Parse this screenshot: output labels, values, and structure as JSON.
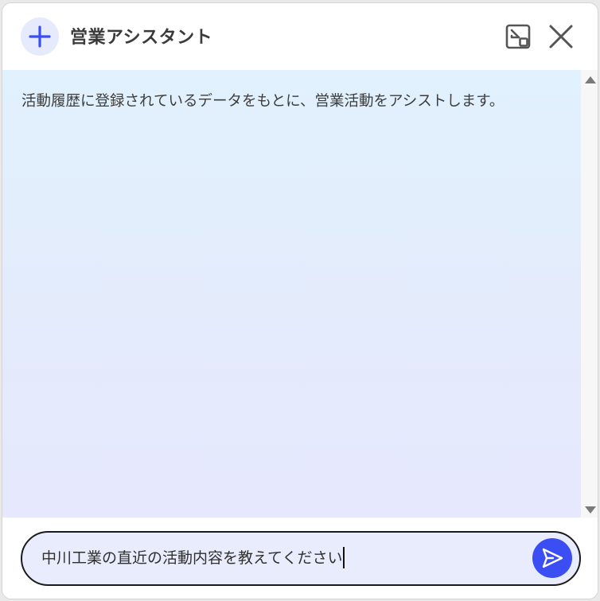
{
  "header": {
    "title": "営業アシスタント",
    "new_icon": "plus-icon",
    "minimize_icon": "minimize-window-icon",
    "close_icon": "close-icon"
  },
  "chat": {
    "messages": [
      {
        "role": "assistant",
        "text": "活動履歴に登録されているデータをもとに、営業活動をアシストします。"
      }
    ]
  },
  "composer": {
    "value": "中川工業の直近の活動内容を教えてください",
    "send_icon": "send-icon"
  },
  "colors": {
    "accent": "#3b4ef3",
    "new_button_bg": "#e6eafd",
    "chat_bg_top": "#e1f1fd",
    "chat_bg_bottom": "#e6e8fd",
    "input_bg": "#e9ecfd"
  }
}
